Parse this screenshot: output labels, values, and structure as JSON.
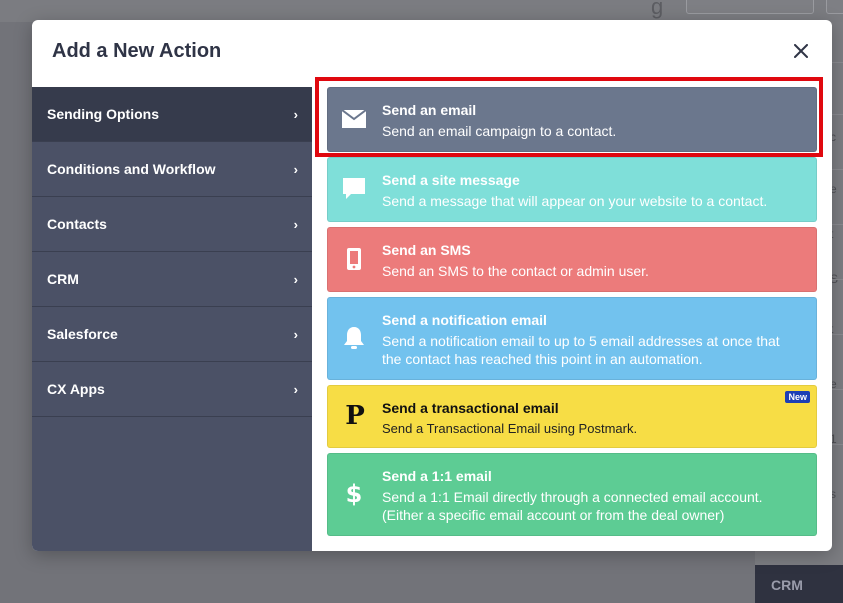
{
  "modal": {
    "title": "Add a New Action",
    "close_icon": "close-icon"
  },
  "sidebar": {
    "items": [
      {
        "label": "Sending Options",
        "active": true
      },
      {
        "label": "Conditions and Workflow",
        "active": false
      },
      {
        "label": "Contacts",
        "active": false
      },
      {
        "label": "CRM",
        "active": false
      },
      {
        "label": "Salesforce",
        "active": false
      },
      {
        "label": "CX Apps",
        "active": false
      }
    ],
    "chevron": "›"
  },
  "actions": [
    {
      "title": "Send an email",
      "desc": "Send an email campaign to a contact.",
      "icon": "envelope-icon",
      "color": "#6b778d",
      "selected": true
    },
    {
      "title": "Send a site message",
      "desc": "Send a message that will appear on your website to a contact.",
      "icon": "chat-bubble-icon",
      "color": "#7fdfd9"
    },
    {
      "title": "Send an SMS",
      "desc": "Send an SMS to the contact or admin user.",
      "icon": "phone-icon",
      "color": "#ec7b7b"
    },
    {
      "title": "Send a notification email",
      "desc": "Send a notification email to up to 5 email addresses at once that the contact has reached this point in an automation.",
      "icon": "bell-icon",
      "color": "#72c2ee"
    },
    {
      "title": "Send a transactional email",
      "desc": "Send a Transactional Email using Postmark.",
      "icon": "postmark-logo-icon",
      "color": "#f7dd45",
      "badge": "New",
      "logo_letter": "P"
    },
    {
      "title": "Send a 1:1 email",
      "desc": "Send a 1:1 Email directly through a connected email account. (Either a specific email account or from the deal owner)",
      "icon": "dollar-icon",
      "color": "#5dcc94"
    }
  ],
  "background": {
    "crm_label": "CRM"
  },
  "colors": {
    "highlight": "#e0080f",
    "sidebar": "#4b5166",
    "sidebar_active": "#363b4c"
  }
}
